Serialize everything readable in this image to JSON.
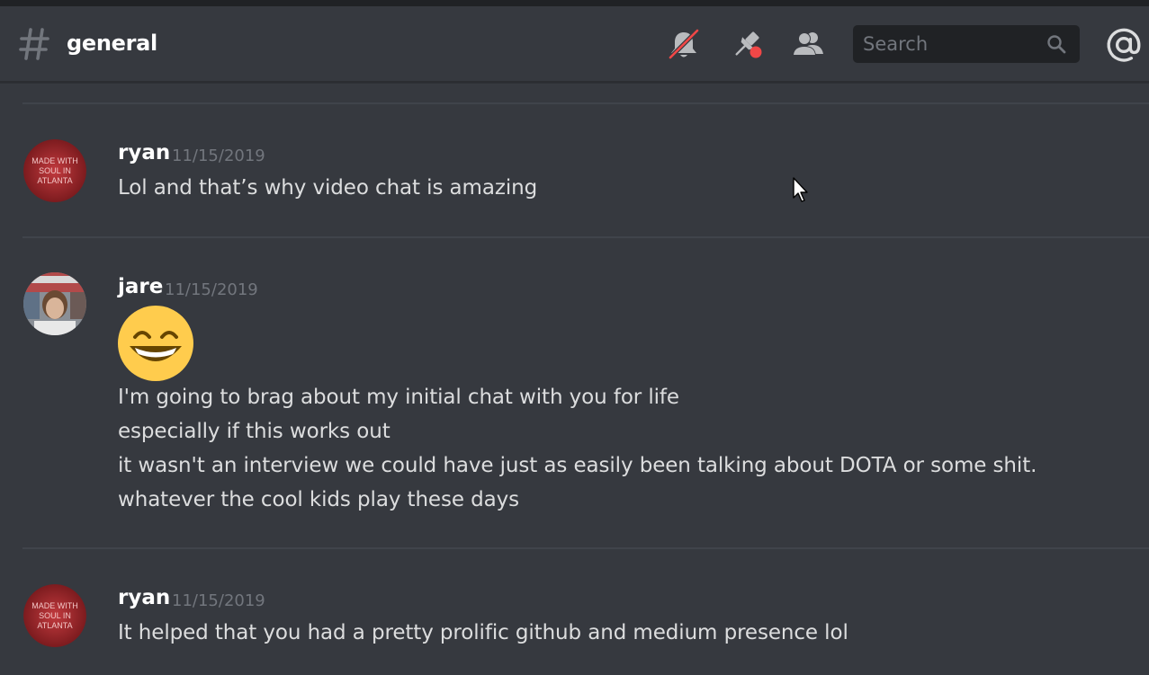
{
  "channel": {
    "name": "general"
  },
  "search": {
    "placeholder": "Search"
  },
  "icons": {
    "channel": "hash-icon",
    "mute": "bell-muted-icon",
    "pins": "pin-icon",
    "members": "members-icon",
    "search": "search-icon",
    "mentions": "at-icon"
  },
  "colors": {
    "background": "#36393f",
    "search_bg": "#202225",
    "timestamp": "#72767d",
    "text": "#dcddde",
    "mute_slash": "#f04747",
    "pin_badge": "#f04747",
    "emoji_yellow": "#ffcc4d"
  },
  "messages": [
    {
      "author": "ryan",
      "timestamp": "11/15/2019",
      "avatar": "made-with-soul-in-atlanta-avatar",
      "avatar_text": [
        "MADE WITH",
        "SOUL IN",
        "ATLANTA"
      ],
      "lines": [
        "Lol and that’s why video chat is amazing"
      ]
    },
    {
      "author": "jare",
      "timestamp": "11/15/2019",
      "avatar": "photo-avatar",
      "emoji": "grinning-smile-emoji",
      "lines": [
        "I'm going to brag about my initial chat with you for life",
        "especially if this works out",
        "it wasn't an interview we could have just as easily been talking about DOTA or some shit.",
        "whatever the cool kids play these days"
      ]
    },
    {
      "author": "ryan",
      "timestamp": "11/15/2019",
      "avatar": "made-with-soul-in-atlanta-avatar",
      "avatar_text": [
        "MADE WITH",
        "SOUL IN",
        "ATLANTA"
      ],
      "lines": [
        "It helped that you had a pretty prolific github and medium presence lol"
      ]
    }
  ]
}
